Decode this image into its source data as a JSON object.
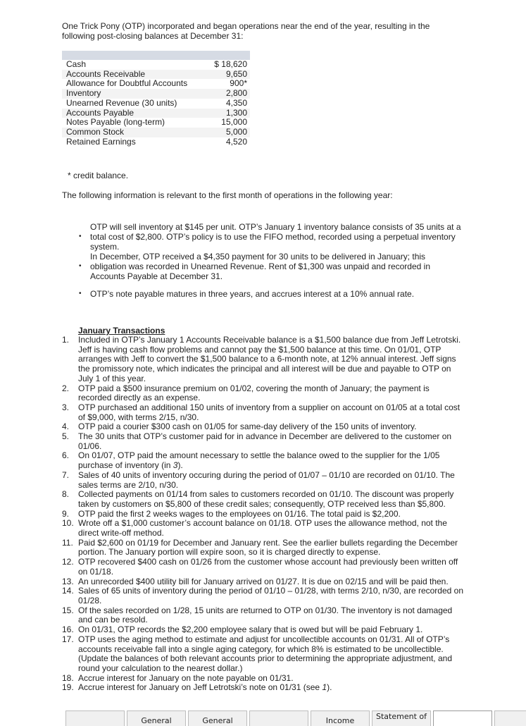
{
  "intro": "One Trick Pony (OTP) incorporated and began operations near the end of the year, resulting in the following post-closing balances at December 31:",
  "balances": [
    {
      "account": "Cash",
      "amount": "$ 18,620"
    },
    {
      "account": "Accounts Receivable",
      "amount": "9,650"
    },
    {
      "account": "Allowance for Doubtful Accounts",
      "amount": "900*"
    },
    {
      "account": "Inventory",
      "amount": "2,800"
    },
    {
      "account": "Unearned Revenue (30 units)",
      "amount": "4,350"
    },
    {
      "account": "Accounts Payable",
      "amount": "1,300"
    },
    {
      "account": "Notes Payable (long-term)",
      "amount": "15,000"
    },
    {
      "account": "Common Stock",
      "amount": "5,000"
    },
    {
      "account": "Retained Earnings",
      "amount": "4,520"
    }
  ],
  "footnote": "* credit balance.",
  "lead": "The following information is relevant to the first month of operations in the following year:",
  "bullet_glyph": "•",
  "bullets": [
    "OTP will sell inventory at $145 per unit. OTP’s January 1 inventory balance consists of 35 units at a total cost of $2,800. OTP’s policy is to use the FIFO method, recorded using a perpetual inventory system.",
    "In December, OTP received a $4,350 payment for 30 units to be delivered in January; this obligation was recorded in Unearned Revenue. Rent of $1,300 was unpaid and recorded in Accounts Payable at December 31.",
    "OTP’s note payable matures in three years, and accrues interest at a 10% annual rate."
  ],
  "transactions_heading": "January Transactions",
  "transactions": [
    {
      "num": "1.",
      "text": "Included in OTP’s January 1 Accounts Receivable balance is a $1,500 balance due from Jeff Letrotski. Jeff is having cash flow problems and cannot pay the $1,500 balance at this time. On 01/01, OTP arranges with Jeff to convert the $1,500 balance to a 6-month note, at 12% annual interest. Jeff signs the promissory note, which indicates the principal and all interest will be due and payable to OTP on July 1 of this year."
    },
    {
      "num": "2.",
      "text": "OTP paid a $500 insurance premium on 01/02, covering the month of January; the payment is recorded directly as an expense."
    },
    {
      "num": "3.",
      "text": "OTP purchased an additional 150 units of inventory from a supplier on account on 01/05 at a total cost of $9,000, with terms 2/15, n/30."
    },
    {
      "num": "4.",
      "text": "OTP paid a courier $300 cash on 01/05 for same-day delivery of the 150 units of inventory."
    },
    {
      "num": "5.",
      "text": "The 30 units that OTP’s customer paid for in advance in December are delivered to the customer on 01/06."
    },
    {
      "num": "6.",
      "text": "On 01/07, OTP paid the amount necessary to settle the balance owed to the supplier for the 1/05 purchase of inventory (in ",
      "italic": "3",
      "after": ")."
    },
    {
      "num": "7.",
      "text": "Sales of 40 units of inventory occuring during the period of 01/07 – 01/10 are recorded on 01/10. The sales terms are 2/10, n/30."
    },
    {
      "num": "8.",
      "text": "Collected payments on 01/14 from sales to customers recorded on 01/10. The discount was properly taken by customers on $5,800 of these credit sales; consequently, OTP received less than $5,800."
    },
    {
      "num": "9.",
      "text": "OTP paid the first 2 weeks wages to the employees on 01/16. The total paid is $2,200."
    },
    {
      "num": "10.",
      "text": "Wrote off a $1,000 customer’s account balance on 01/18. OTP uses the allowance method, not the direct write-off method."
    },
    {
      "num": "11.",
      "text": "Paid $2,600 on 01/19 for December and January rent. See the earlier bullets regarding the December portion. The January portion will expire soon, so it is charged directly to expense."
    },
    {
      "num": "12.",
      "text": "OTP recovered $400 cash on 01/26 from the customer whose account had previously been written off on 01/18."
    },
    {
      "num": "13.",
      "text": "An unrecorded $400 utility bill for January arrived on 01/27. It is due on 02/15 and will be paid then."
    },
    {
      "num": "14.",
      "text": "Sales of 65 units of inventory during the period of 01/10 – 01/28, with terms 2/10, n/30, are recorded on 01/28."
    },
    {
      "num": "15.",
      "text": "Of the sales recorded on 1/28, 15 units are returned to OTP on 01/30. The inventory is not damaged and can be resold."
    },
    {
      "num": "16.",
      "text": "On 01/31, OTP records the $2,200 employee salary that is owed but will be paid February 1."
    },
    {
      "num": "17.",
      "text": "OTP uses the aging method to estimate and adjust for uncollectible accounts on 01/31. All of OTP’s accounts receivable fall into a single aging category, for which 8% is estimated to be uncollectible. (Update the balances of both relevant accounts prior to determining the appropriate adjustment, and round your calculation to the nearest dollar.)"
    },
    {
      "num": "18.",
      "text": "Accrue interest for January on the note payable on 01/31."
    },
    {
      "num": "19.",
      "text": "Accrue interest for January on Jeff Letrotski’s note on 01/31 (see ",
      "italic": "1",
      "after": ")."
    }
  ],
  "tabs": [
    {
      "label": ""
    },
    {
      "label": "General"
    },
    {
      "label": "General"
    },
    {
      "label": ""
    },
    {
      "label": "Income"
    },
    {
      "label": "Statement of"
    },
    {
      "label": ""
    },
    {
      "label": ""
    }
  ]
}
